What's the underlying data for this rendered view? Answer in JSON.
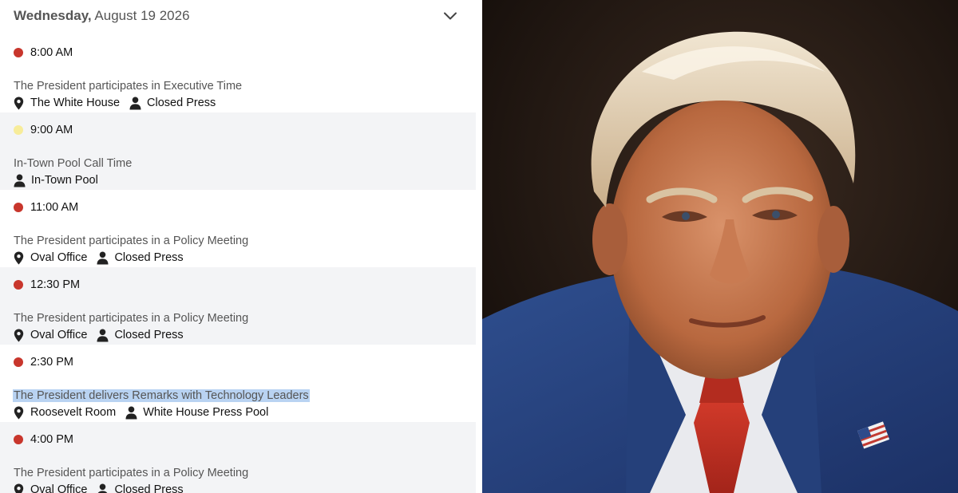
{
  "schedule": {
    "date": {
      "weekday": "Wednesday,",
      "rest": " August 19 2026"
    },
    "events": [
      {
        "time": "8:00 AM",
        "dot_color": "#c8362c",
        "title": "The President participates in Executive Time",
        "location": "The White House",
        "press": "Closed Press"
      },
      {
        "time": "9:00 AM",
        "dot_color": "#f7ec9a",
        "title": "In-Town Pool Call Time",
        "press": "In-Town Pool"
      },
      {
        "time": "11:00 AM",
        "dot_color": "#c8362c",
        "title": "The President participates in a Policy Meeting",
        "location": "Oval Office",
        "press": "Closed Press"
      },
      {
        "time": "12:30 PM",
        "dot_color": "#c8362c",
        "title": "The President participates in a Policy Meeting",
        "location": "Oval Office",
        "press": "Closed Press"
      },
      {
        "time": "2:30 PM",
        "dot_color": "#c8362c",
        "title": "The President delivers Remarks with Technology Leaders",
        "location": "Roosevelt Room",
        "press": "White House Press Pool",
        "title_selected": true
      },
      {
        "time": "4:00 PM",
        "dot_color": "#c8362c",
        "title": "The President participates in a Policy Meeting",
        "location": "Oval Office",
        "press": "Closed Press"
      }
    ],
    "icons": {
      "location": "map-pin-icon",
      "press": "person-icon",
      "expand": "chevron-down-icon"
    }
  },
  "colors": {
    "status_red": "#c8362c",
    "status_yellow": "#f7ec9a",
    "row_shade": "#f3f4f6",
    "selection": "#b9d3f2"
  }
}
